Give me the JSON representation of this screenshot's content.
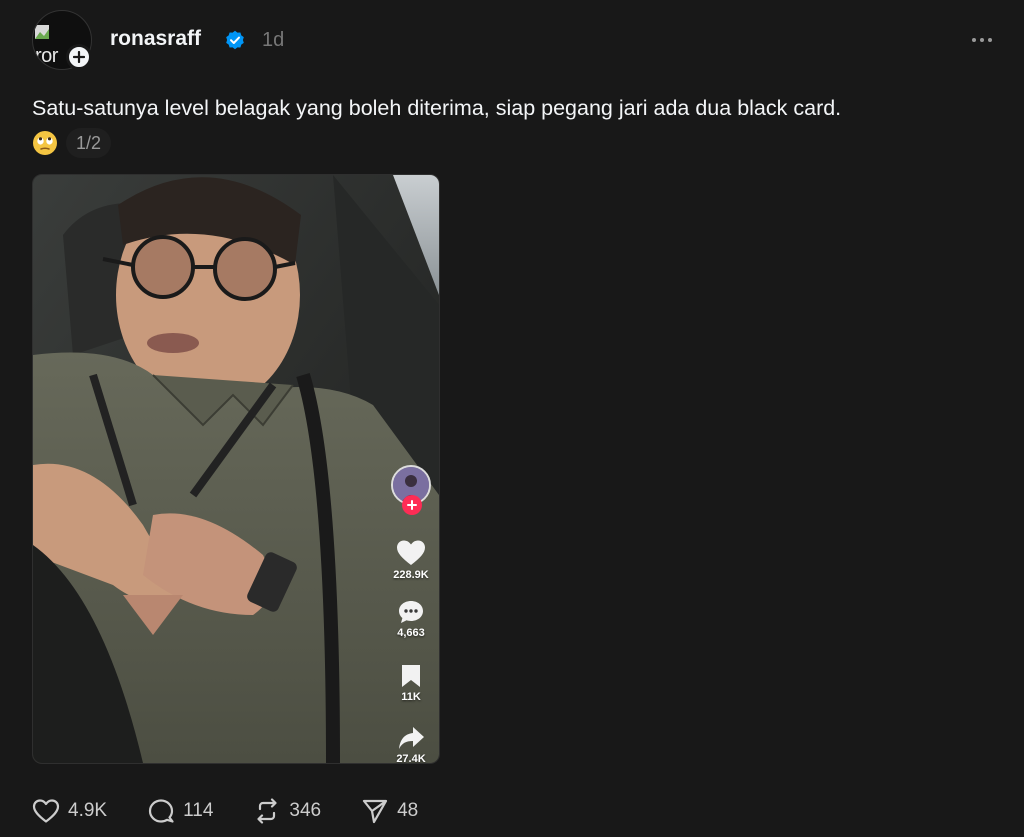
{
  "post": {
    "avatar_alt": "ror",
    "username": "ronasraff",
    "time": "1d",
    "caption": "Satu-satunya level belagak yang boleh diterima, siap pegang jari ada dua black card.",
    "emoji": "🙄",
    "media_counter": "1/2"
  },
  "video_overlay": {
    "likes": "228.9K",
    "comments": "4,663",
    "saves": "11K",
    "shares": "27.4K"
  },
  "actions": {
    "likes": "4.9K",
    "replies": "114",
    "reposts": "346",
    "shares": "48"
  },
  "colors": {
    "background": "#181818",
    "verified": "#0095f6",
    "tiktok_plus": "#fe2c55"
  }
}
